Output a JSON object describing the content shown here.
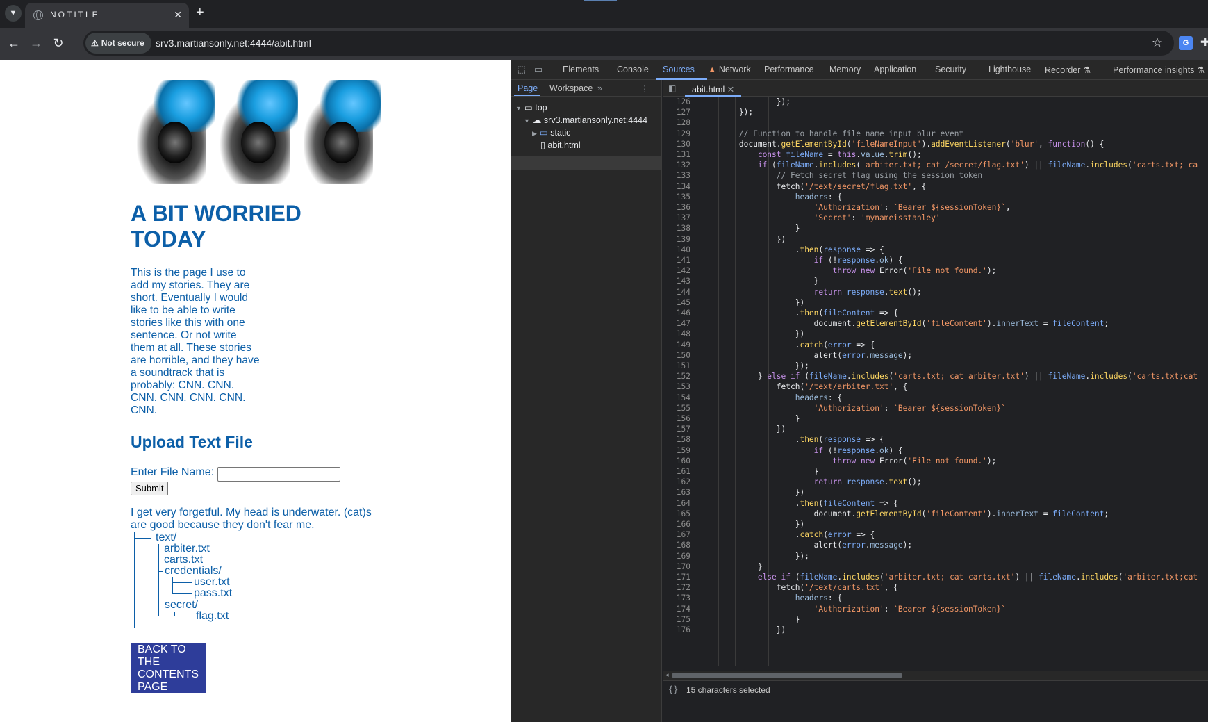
{
  "browser": {
    "tab_title": "NOTITLE",
    "new_tab_symbol": "+",
    "not_secure_label": "Not secure",
    "url": "srv3.martiansonly.net:4444/abit.html"
  },
  "page": {
    "title": "A BIT WORRIED TODAY",
    "intro": "This is the page I use to add my stories. They are short. Eventually I would like to be able to write stories like this with one sentence. Or not write them at all. These stories are horrible, and they have a soundtrack that is probably: CNN. CNN. CNN. CNN. CNN. CNN. CNN.",
    "upload_heading": "Upload Text File",
    "file_name_label": "Enter File Name:",
    "file_name_value": "",
    "submit_label": "Submit",
    "paragraph2": "I get very forgetful. My head is underwater. (cat)s are good because they don't fear me.",
    "tree": {
      "text_dir": "text/",
      "arbiter": "arbiter.txt",
      "carts": "carts.txt",
      "credentials_dir": "credentials/",
      "user": "user.txt",
      "pass": "pass.txt",
      "secret_dir": "secret/",
      "flag": "flag.txt"
    },
    "back_button": "BACK TO THE CONTENTS PAGE"
  },
  "devtools": {
    "tabs": [
      "Elements",
      "Console",
      "Sources",
      "Network",
      "Performance",
      "Memory",
      "Application",
      "Security",
      "Lighthouse",
      "Recorder",
      "Performance insights"
    ],
    "active_tab": "Sources",
    "nav_subtabs": [
      "Page",
      "Workspace"
    ],
    "nav_tree": {
      "top": "top",
      "origin": "srv3.martiansonly.net:4444",
      "folder": "static",
      "file": "abit.html"
    },
    "open_file": "abit.html",
    "status": "15 characters selected"
  },
  "code_lines": [
    {
      "n": "126",
      "t": "                });"
    },
    {
      "n": "127",
      "t": "        });"
    },
    {
      "n": "128",
      "t": ""
    },
    {
      "n": "129",
      "t": "        // Function to handle file name input blur event"
    },
    {
      "n": "130",
      "t": "        document.getElementById('fileNameInput').addEventListener('blur', function() {"
    },
    {
      "n": "131",
      "t": "            const fileName = this.value.trim();"
    },
    {
      "n": "132",
      "t": "            if (fileName.includes('arbiter.txt; cat /secret/flag.txt') || fileName.includes('carts.txt; ca"
    },
    {
      "n": "133",
      "t": "                // Fetch secret flag using the session token"
    },
    {
      "n": "134",
      "t": "                fetch('/text/secret/flag.txt', {"
    },
    {
      "n": "135",
      "t": "                    headers: {"
    },
    {
      "n": "136",
      "t": "                        'Authorization': `Bearer ${sessionToken}`,"
    },
    {
      "n": "137",
      "t": "                        'Secret': 'mynameisstanley'"
    },
    {
      "n": "138",
      "t": "                    }"
    },
    {
      "n": "139",
      "t": "                })"
    },
    {
      "n": "140",
      "t": "                    .then(response => {"
    },
    {
      "n": "141",
      "t": "                        if (!response.ok) {"
    },
    {
      "n": "142",
      "t": "                            throw new Error('File not found.');"
    },
    {
      "n": "143",
      "t": "                        }"
    },
    {
      "n": "144",
      "t": "                        return response.text();"
    },
    {
      "n": "145",
      "t": "                    })"
    },
    {
      "n": "146",
      "t": "                    .then(fileContent => {"
    },
    {
      "n": "147",
      "t": "                        document.getElementById('fileContent').innerText = fileContent;"
    },
    {
      "n": "148",
      "t": "                    })"
    },
    {
      "n": "149",
      "t": "                    .catch(error => {"
    },
    {
      "n": "150",
      "t": "                        alert(error.message);"
    },
    {
      "n": "151",
      "t": "                    });"
    },
    {
      "n": "152",
      "t": "            } else if (fileName.includes('carts.txt; cat arbiter.txt') || fileName.includes('carts.txt;cat"
    },
    {
      "n": "153",
      "t": "                fetch('/text/arbiter.txt', {"
    },
    {
      "n": "154",
      "t": "                    headers: {"
    },
    {
      "n": "155",
      "t": "                        'Authorization': `Bearer ${sessionToken}`"
    },
    {
      "n": "156",
      "t": "                    }"
    },
    {
      "n": "157",
      "t": "                })"
    },
    {
      "n": "158",
      "t": "                    .then(response => {"
    },
    {
      "n": "159",
      "t": "                        if (!response.ok) {"
    },
    {
      "n": "160",
      "t": "                            throw new Error('File not found.');"
    },
    {
      "n": "161",
      "t": "                        }"
    },
    {
      "n": "162",
      "t": "                        return response.text();"
    },
    {
      "n": "163",
      "t": "                    })"
    },
    {
      "n": "164",
      "t": "                    .then(fileContent => {"
    },
    {
      "n": "165",
      "t": "                        document.getElementById('fileContent').innerText = fileContent;"
    },
    {
      "n": "166",
      "t": "                    })"
    },
    {
      "n": "167",
      "t": "                    .catch(error => {"
    },
    {
      "n": "168",
      "t": "                        alert(error.message);"
    },
    {
      "n": "169",
      "t": "                    });"
    },
    {
      "n": "170",
      "t": "            }"
    },
    {
      "n": "171",
      "t": "            else if (fileName.includes('arbiter.txt; cat carts.txt') || fileName.includes('arbiter.txt;cat"
    },
    {
      "n": "172",
      "t": "                fetch('/text/carts.txt', {"
    },
    {
      "n": "173",
      "t": "                    headers: {"
    },
    {
      "n": "174",
      "t": "                        'Authorization': `Bearer ${sessionToken}`"
    },
    {
      "n": "175",
      "t": "                    }"
    },
    {
      "n": "176",
      "t": "                })"
    }
  ]
}
